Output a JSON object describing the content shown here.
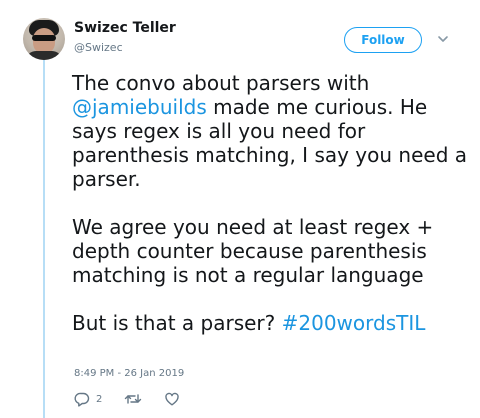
{
  "author": {
    "name": "Swizec Teller",
    "handle": "@Swizec",
    "avatar_icon": "user-avatar-photo"
  },
  "follow_button": {
    "label": "Follow"
  },
  "menu": {
    "icon": "chevron-down-icon"
  },
  "tweet": {
    "paragraph1": {
      "before": "The convo about parsers with ",
      "mention": "@jamiebuilds",
      "after": " made me curious. He says regex is all you need for parenthesis matching, I say you need a parser."
    },
    "paragraph2": "We agree you need at least regex + depth counter because parenthesis matching is not a regular language",
    "paragraph3": {
      "before": "But is that a parser? ",
      "hashtag": "#200wordsTIL"
    },
    "timestamp": "8:49 PM - 26 Jan 2019"
  },
  "actions": {
    "reply": {
      "icon": "reply-icon",
      "count": "2"
    },
    "retweet": {
      "icon": "retweet-icon"
    },
    "like": {
      "icon": "heart-icon"
    }
  },
  "colors": {
    "accent": "#1da1f2",
    "link": "#1b95e0",
    "thread_line": "#b7def6",
    "muted": "#657786"
  }
}
